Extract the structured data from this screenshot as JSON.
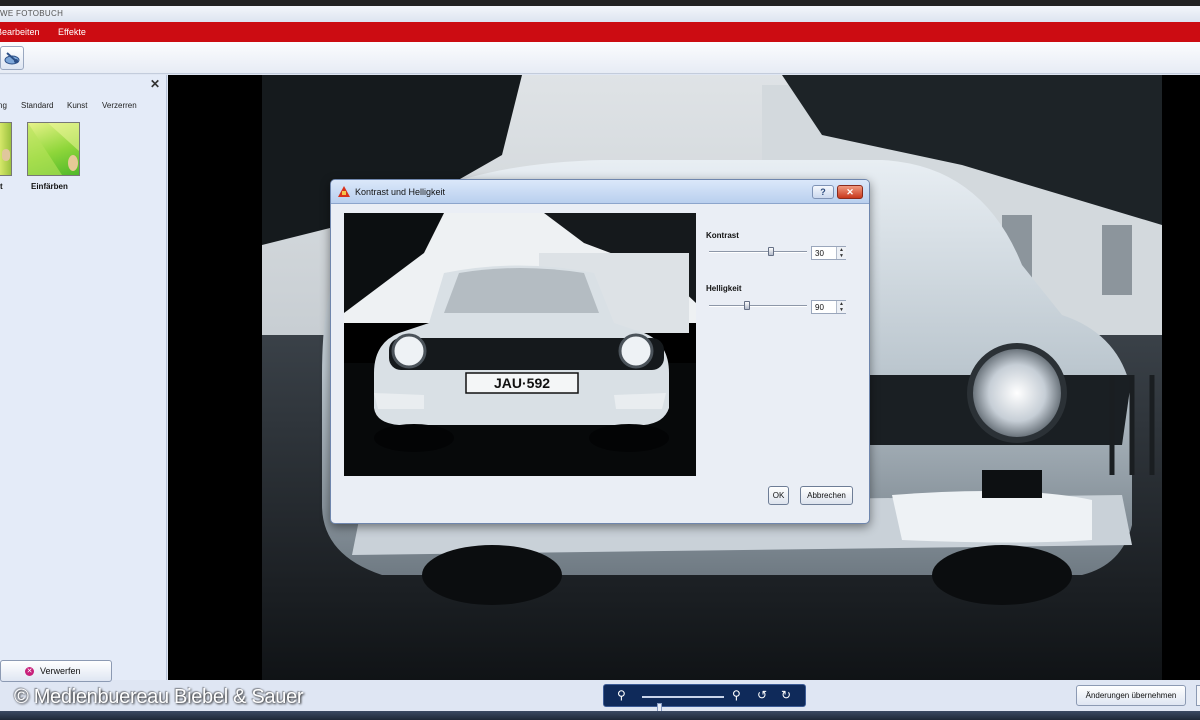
{
  "window": {
    "title": "WE FOTOBUCH"
  },
  "menu": {
    "items": [
      "Bearbeiten",
      "Effekte"
    ]
  },
  "left_panel": {
    "tabs": [
      "ng",
      "Standard",
      "Kunst",
      "Verzerren"
    ],
    "effects": [
      {
        "label": "t"
      },
      {
        "label": "Einfärben"
      }
    ],
    "discard_label": "Verwerfen"
  },
  "dialog": {
    "title": "Kontrast und Helligkeit",
    "help_glyph": "?",
    "close_glyph": "✕",
    "contrast": {
      "label": "Kontrast",
      "value": "30",
      "level_percent": 64
    },
    "brightness": {
      "label": "Helligkeit",
      "value": "90",
      "level_percent": 38
    },
    "ok_label": "OK",
    "cancel_label": "Abbrechen",
    "preview_plate": "JAU·592"
  },
  "footer": {
    "apply_label": "Änderungen übernehmen",
    "copyright": "© Medienbuereau Biebel & Sauer",
    "zoom_level_percent": 20
  },
  "icons": {
    "zoom_out": "zoom-out-icon",
    "zoom_in": "zoom-in-icon",
    "rotate_left": "rotate-left-icon",
    "rotate_right": "rotate-right-icon"
  },
  "colors": {
    "menu_red": "#cc0c12",
    "zoom_bar": "#0f2a5a"
  }
}
